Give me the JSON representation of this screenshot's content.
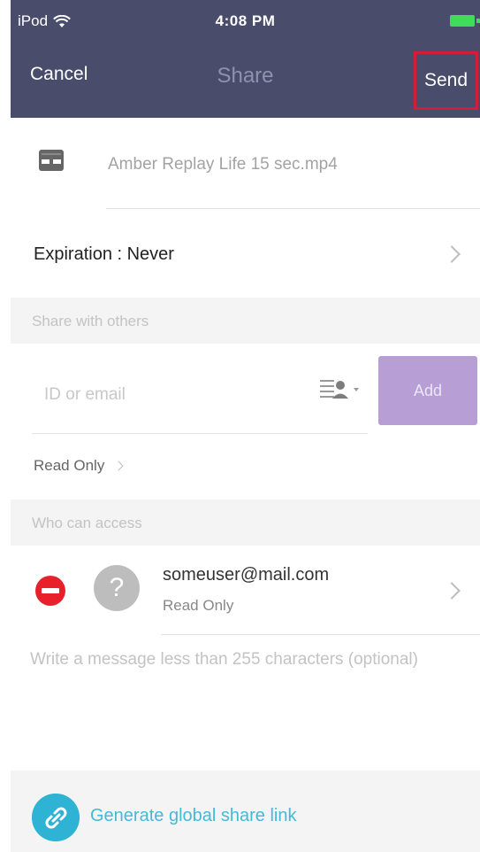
{
  "status_bar": {
    "carrier": "iPod",
    "time": "4:08 PM"
  },
  "nav": {
    "cancel_label": "Cancel",
    "title": "Share",
    "send_label": "Send"
  },
  "file": {
    "name": "Amber Replay Life 15 sec.mp4",
    "icon": "film-file-icon"
  },
  "expiration": {
    "label": "Expiration : Never"
  },
  "share_section": {
    "header": "Share with others",
    "input_placeholder": "ID or email",
    "input_value": "",
    "add_label": "Add",
    "permission_label": "Read Only"
  },
  "access_section": {
    "header": "Who can access",
    "entries": [
      {
        "email": "someuser@mail.com",
        "permission": "Read Only",
        "avatar_glyph": "?"
      }
    ]
  },
  "message": {
    "placeholder": "Write a message less than 255 characters (optional)",
    "value": ""
  },
  "footer": {
    "label": "Generate global share link"
  },
  "colors": {
    "nav_bg": "#4a4c6c",
    "send_highlight": "#d11f3a",
    "add_button": "#b79fd6",
    "remove_red": "#e8202c",
    "link_blue": "#2fb3d4",
    "battery_green": "#3ddc5b"
  }
}
